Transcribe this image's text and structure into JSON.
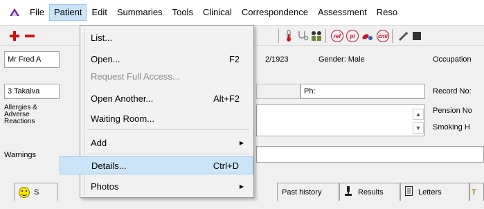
{
  "menubar": {
    "items": [
      "File",
      "Patient",
      "Edit",
      "Summaries",
      "Tools",
      "Clinical",
      "Correspondence",
      "Assessment",
      "Reso"
    ],
    "active_index": 1
  },
  "patient": {
    "name": "Mr Fred A",
    "dob": "2/1923",
    "gender": "Gender: Male",
    "occupation_label": "Occupation",
    "address": "3 Takalva",
    "ph_label": "Ph:",
    "record_label": "Record No:",
    "allergies_label": "Allergies & Adverse Reactions",
    "pension_label": "Pension No",
    "smoking_label": "Smoking H",
    "warnings_label": "Warnings"
  },
  "toolbar": {
    "icon_ref": "ref",
    "icon_pi": "pi",
    "icon_cmi": "cmi"
  },
  "tabs": {
    "summary": "S",
    "past_history": "Past history",
    "results": "Results",
    "letters": "Letters"
  },
  "dropdown": {
    "items": [
      {
        "label": "List...",
        "shortcut": "",
        "submenu": false,
        "disabled": false
      },
      {
        "label": "Open...",
        "shortcut": "F2",
        "submenu": false,
        "disabled": false
      },
      {
        "label": "Request Full Access...",
        "shortcut": "",
        "submenu": false,
        "disabled": true
      },
      {
        "label": "Open Another...",
        "shortcut": "Alt+F2",
        "submenu": false,
        "disabled": false
      },
      {
        "label": "Waiting Room...",
        "shortcut": "",
        "submenu": false,
        "disabled": false
      },
      {
        "label": "Add",
        "shortcut": "",
        "submenu": true,
        "disabled": false
      },
      {
        "label": "Details...",
        "shortcut": "Ctrl+D",
        "submenu": false,
        "disabled": false,
        "highlighted": true
      },
      {
        "label": "Photos",
        "shortcut": "",
        "submenu": true,
        "disabled": false
      }
    ]
  },
  "colors": {
    "highlight": "#cce4f7",
    "highlight_border": "#99c9ef",
    "menu_bg": "#f2f2f2",
    "panel_bg": "#f0f0f0",
    "accent_red": "#c8102e"
  }
}
